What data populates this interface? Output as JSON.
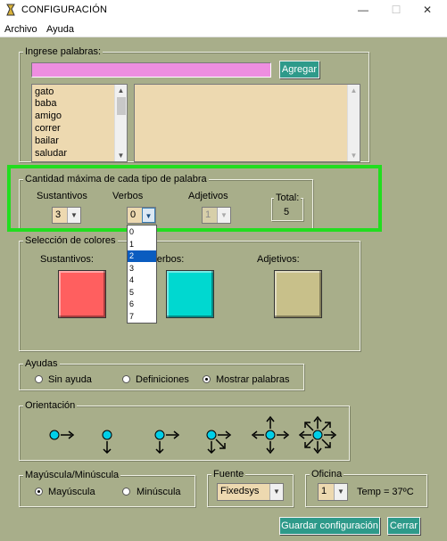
{
  "window": {
    "title": "CONFIGURACIÓN"
  },
  "menu": {
    "items": [
      "Archivo",
      "Ayuda"
    ]
  },
  "words": {
    "legend": "Ingrese palabras:",
    "input_value": "",
    "add_button": "Agregar",
    "list": [
      "gato",
      "baba",
      "amigo",
      "correr",
      "bailar",
      "saludar"
    ],
    "right_list": []
  },
  "cantidad": {
    "legend": "Cantidad máxima de cada tipo de palabra",
    "sustantivos_label": "Sustantivos",
    "verbos_label": "Verbos",
    "adjetivos_label": "Adjetivos",
    "total_label": "Total:",
    "sustantivos_value": "3",
    "verbos_value": "0",
    "adjetivos_value": "1",
    "total_value": "5",
    "verbos_options": [
      "0",
      "1",
      "2",
      "3",
      "4",
      "5",
      "6",
      "7"
    ],
    "verbos_highlighted": "2"
  },
  "colores": {
    "legend": "Selección de colores",
    "sustantivos_label": "Sustantivos:",
    "verbos_label": "Verbos:",
    "adjetivos_label": "Adjetivos:",
    "sustantivos_color": "#ff5f5f",
    "verbos_color": "#00d8d0",
    "adjetivos_color": "#c8c08a"
  },
  "ayudas": {
    "legend": "Ayudas",
    "options": [
      "Sin ayuda",
      "Definiciones",
      "Mostrar palabras"
    ],
    "selected": "Mostrar palabras"
  },
  "orientacion": {
    "legend": "Orientación",
    "icons": [
      "orient-right-icon",
      "orient-down-icon",
      "orient-right-down-icon",
      "orient-right-down-diagonal-icon",
      "orient-four-way-icon",
      "orient-eight-way-icon"
    ]
  },
  "mayuscula": {
    "legend": "Mayúscula/Minúscula",
    "options": [
      "Mayúscula",
      "Minúscula"
    ],
    "selected": "Mayúscula"
  },
  "fuente": {
    "legend": "Fuente",
    "value": "Fixedsys"
  },
  "oficina": {
    "legend": "Oficina",
    "value": "1",
    "temp_text": "Temp = 37ºC"
  },
  "buttons": {
    "save": "Guardar configuración",
    "close": "Cerrar"
  },
  "colors": {
    "accent": "#2e9a8a",
    "highlight_frame": "#22dd1f",
    "background": "#a8ae8a",
    "input_pink": "#ee8ee0",
    "list_bg": "#edd9b0"
  }
}
